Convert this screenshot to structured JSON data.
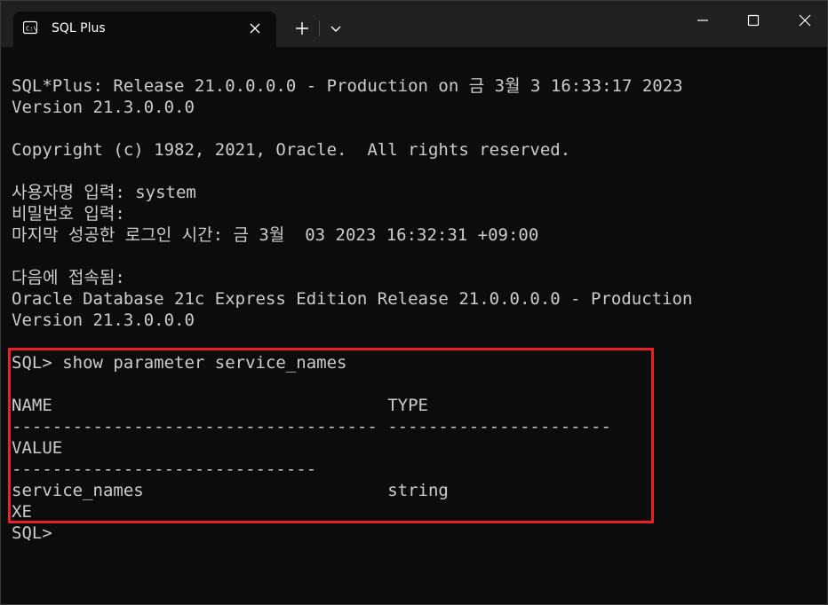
{
  "window": {
    "tab_title": "SQL Plus",
    "tab_icon": "terminal-icon",
    "controls": [
      "close-icon",
      "plus-icon",
      "chevron-down-icon",
      "minimize-icon",
      "maximize-icon",
      "window-close-icon"
    ]
  },
  "terminal": {
    "lines": [
      "",
      "SQL*Plus: Release 21.0.0.0.0 - Production on 금 3월 3 16:33:17 2023",
      "Version 21.3.0.0.0",
      "",
      "Copyright (c) 1982, 2021, Oracle.  All rights reserved.",
      "",
      "사용자명 입력: system",
      "비밀번호 입력:",
      "마지막 성공한 로그인 시간: 금 3월  03 2023 16:32:31 +09:00",
      "",
      "다음에 접속됨:",
      "Oracle Database 21c Express Edition Release 21.0.0.0.0 - Production",
      "Version 21.3.0.0.0",
      "",
      "SQL> show parameter service_names",
      "",
      "NAME                                 TYPE",
      "------------------------------------ ----------------------",
      "VALUE",
      "------------------------------",
      "service_names                        string",
      "XE",
      "SQL>"
    ]
  },
  "colors": {
    "background": "#0c0c0c",
    "titlebar": "#202020",
    "text": "#cccccc",
    "highlight_border": "#e8202a"
  }
}
